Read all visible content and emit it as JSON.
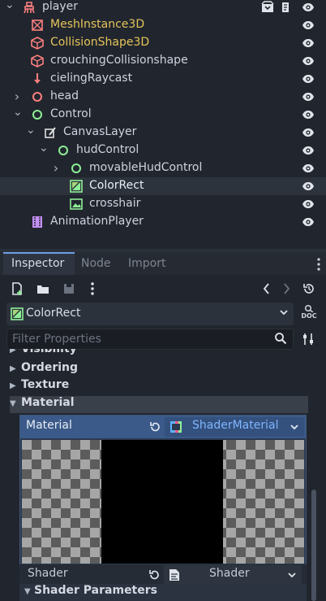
{
  "scene_tree": {
    "nodes": [
      {
        "label": "player",
        "label_color": "#cdd3de",
        "icon": "character-body-icon",
        "icon_color": "#fc7f7f",
        "depth": 0,
        "expanded": true,
        "has_children": true
      },
      {
        "label": "MeshInstance3D",
        "label_color": "#e6c35a",
        "icon": "mesh-instance-icon",
        "icon_color": "#fc7f7f",
        "depth": 1,
        "has_children": false
      },
      {
        "label": "CollisionShape3D",
        "label_color": "#e6c35a",
        "icon": "collision-shape-icon",
        "icon_color": "#fc7f7f",
        "depth": 1,
        "has_children": false
      },
      {
        "label": "crouchingCollisionshape",
        "label_color": "#cdd3de",
        "icon": "collision-shape-icon",
        "icon_color": "#fc7f7f",
        "depth": 1,
        "has_children": false
      },
      {
        "label": "cielingRaycast",
        "label_color": "#cdd3de",
        "icon": "raycast-icon",
        "icon_color": "#fc7f7f",
        "depth": 1,
        "has_children": false
      },
      {
        "label": "head",
        "label_color": "#cdd3de",
        "icon": "node3d-icon",
        "icon_color": "#fc7f7f",
        "depth": 1,
        "has_children": true,
        "expanded": false
      },
      {
        "label": "Control",
        "label_color": "#cdd3de",
        "icon": "control-icon",
        "icon_color": "#8eef97",
        "depth": 1,
        "has_children": true,
        "expanded": true
      },
      {
        "label": "CanvasLayer",
        "label_color": "#cdd3de",
        "icon": "canvas-layer-icon",
        "icon_color": "#e0e0e0",
        "depth": 2,
        "has_children": true,
        "expanded": true
      },
      {
        "label": "hudControl",
        "label_color": "#cdd3de",
        "icon": "control-icon",
        "icon_color": "#8eef97",
        "depth": 3,
        "has_children": true,
        "expanded": true
      },
      {
        "label": "movableHudControl",
        "label_color": "#cdd3de",
        "icon": "control-icon",
        "icon_color": "#8eef97",
        "depth": 4,
        "has_children": true,
        "expanded": false
      },
      {
        "label": "ColorRect",
        "label_color": "#e8edf5",
        "icon": "color-rect-icon",
        "icon_color": "#8eef97",
        "depth": 4,
        "has_children": false,
        "selected": true
      },
      {
        "label": "crosshair",
        "label_color": "#cdd3de",
        "icon": "texture-rect-icon",
        "icon_color": "#8eef97",
        "depth": 4,
        "has_children": false
      },
      {
        "label": "AnimationPlayer",
        "label_color": "#cdd3de",
        "icon": "animation-player-icon",
        "icon_color": "#c38ef1",
        "depth": 1,
        "has_children": false
      }
    ]
  },
  "inspector": {
    "tabs": [
      {
        "label": "Inspector",
        "active": true
      },
      {
        "label": "Node",
        "active": false
      },
      {
        "label": "Import",
        "active": false
      }
    ],
    "selected_node": "ColorRect",
    "doc_label": "DOC",
    "filter_placeholder": "Filter Properties",
    "sections": {
      "visibility": "Visibility",
      "ordering": "Ordering",
      "texture": "Texture",
      "material": "Material"
    },
    "material_property": {
      "label": "Material",
      "value": "ShaderMaterial"
    },
    "shader_property": {
      "label": "Shader",
      "value": "Shader"
    },
    "shader_parameters": "Shader Parameters"
  },
  "colors": {
    "accent": "#6d9fe6",
    "resource_link": "#7fb5ff",
    "selected_row_bg": "#2d333c",
    "panel_bg": "#21262e"
  }
}
